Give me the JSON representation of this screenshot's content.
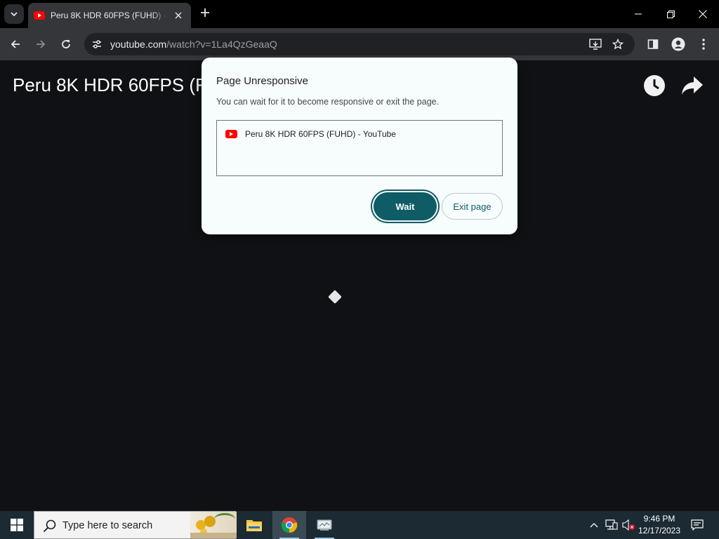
{
  "browser": {
    "tab_title": "Peru 8K HDR 60FPS (FUHD) - YouTube",
    "url_host": "youtube.com",
    "url_path": "/watch?v=1La4QzGeaaQ"
  },
  "page": {
    "video_title": "Peru 8K HDR 60FPS (FUHD) - YouTube"
  },
  "dialog": {
    "title": "Page Unresponsive",
    "body": "You can wait for it to become responsive or exit the page.",
    "items": [
      {
        "label": "Peru 8K HDR 60FPS (FUHD) - YouTube",
        "icon": "youtube-icon"
      }
    ],
    "wait_label": "Wait",
    "exit_label": "Exit page"
  },
  "taskbar": {
    "search_placeholder": "Type here to search",
    "apps": [
      "file-explorer-icon",
      "chrome-icon",
      "network-app-icon"
    ],
    "time": "9:46 PM",
    "date": "12/17/2023"
  },
  "colors": {
    "accent": "#0f5b66",
    "page_bg": "#0f1114",
    "toolbar": "#35363a",
    "taskbar": "#1b2a33"
  }
}
